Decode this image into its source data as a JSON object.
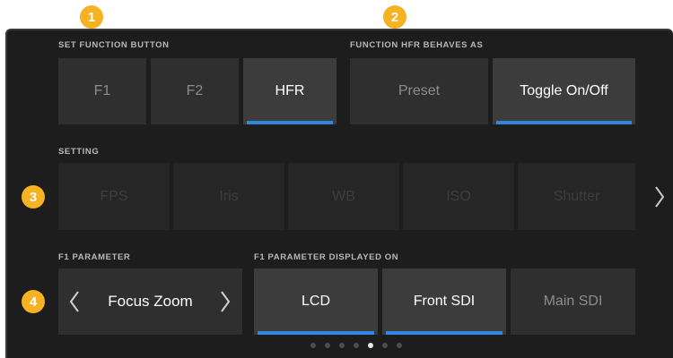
{
  "callouts": [
    "1",
    "2",
    "3",
    "4"
  ],
  "function_button": {
    "label": "SET FUNCTION BUTTON",
    "options": [
      "F1",
      "F2",
      "HFR"
    ],
    "selected": "HFR"
  },
  "hfr_behaviour": {
    "label": "FUNCTION HFR BEHAVES AS",
    "options": [
      "Preset",
      "Toggle On/Off"
    ],
    "selected": "Toggle On/Off"
  },
  "setting": {
    "label": "SETTING",
    "options": [
      "FPS",
      "Iris",
      "WB",
      "ISO",
      "Shutter"
    ],
    "next_icon": "chevron-right-icon"
  },
  "parameter": {
    "label": "F1 PARAMETER",
    "value": "Focus Zoom",
    "prev_icon": "chevron-left-icon",
    "next_icon": "chevron-right-icon"
  },
  "displayed_on": {
    "label": "F1 PARAMETER DISPLAYED ON",
    "options": [
      "LCD",
      "Front SDI",
      "Main SDI"
    ],
    "selected": [
      "LCD",
      "Front SDI"
    ]
  },
  "pagination": {
    "count": 7,
    "current": 5
  },
  "colors": {
    "accent": "#2f86de",
    "callout": "#f5b324",
    "background": "#1d1d1d"
  }
}
